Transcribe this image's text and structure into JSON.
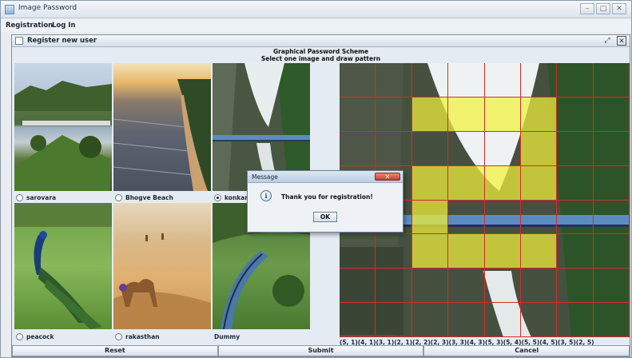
{
  "window": {
    "title": "Image Password"
  },
  "menu": [
    "Registration",
    "Log In"
  ],
  "frame": {
    "title": "Register new user"
  },
  "headings": {
    "line1": "Graphical Password Scheme",
    "line2": "Select one image and draw pattern"
  },
  "images": [
    {
      "label": "sarovara",
      "selected": false
    },
    {
      "label": "Bhogve Beach",
      "selected": false
    },
    {
      "label": "konkan",
      "selected": true
    },
    {
      "label": "peacock",
      "selected": false
    },
    {
      "label": "rakasthan",
      "selected": false
    },
    {
      "label": "Dummy",
      "selected": false
    }
  ],
  "pattern": {
    "coordinates_text": "(5, 1)(4, 1)(3, 1)(2, 1)(2, 2)(2, 3)(3, 3)(4, 3)(5, 3)(5, 4)(5, 5)(4, 5)(3, 5)(2, 5)",
    "highlight_color": "#f2f23a",
    "grid_color": "#d62b2b",
    "grid_rows": 8,
    "grid_cols": 8
  },
  "buttons": {
    "reset": "Reset",
    "submit": "Submit",
    "cancel": "Cancel"
  },
  "dialog": {
    "title": "Message",
    "text": "Thank you for registration!",
    "ok": "OK"
  }
}
